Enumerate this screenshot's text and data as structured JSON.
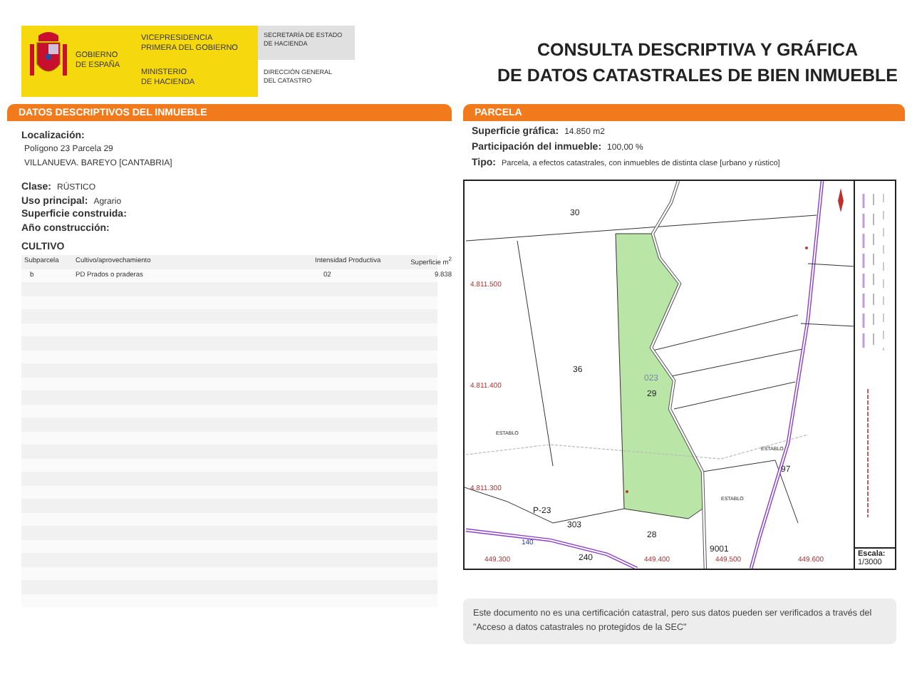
{
  "header": {
    "gov_lines": [
      "GOBIERNO",
      "DE ESPAÑA"
    ],
    "ministry_top": [
      "VICEPRESIDENCIA",
      "PRIMERA DEL GOBIERNO"
    ],
    "ministry_bottom": [
      "MINISTERIO",
      "DE HACIENDA"
    ],
    "secretariat": [
      "SECRETARÍA DE ESTADO",
      "DE HACIENDA"
    ],
    "directorate": [
      "DIRECCIÓN GENERAL",
      "DEL CATASTRO"
    ],
    "title_lines": [
      "CONSULTA DESCRIPTIVA Y GRÁFICA",
      "DE DATOS CATASTRALES DE BIEN INMUEBLE"
    ]
  },
  "descriptive": {
    "title": "DATOS DESCRIPTIVOS DEL INMUEBLE",
    "location_label": "Localización:",
    "location_lines": [
      "Polígono 23 Parcela 29",
      "VILLANUEVA. BAREYO [CANTABRIA]"
    ],
    "fields": [
      {
        "label": "Clase:",
        "value": "RÚSTICO"
      },
      {
        "label": "Uso principal:",
        "value": "Agrario"
      },
      {
        "label": "Superficie construida:"
      },
      {
        "label": "Año construcción:"
      }
    ],
    "cultivo": {
      "title": "CULTIVO",
      "columns": [
        "Subparcela",
        "Cultivo/aprovechamiento",
        "Intensidad Productiva",
        "Superficie m$^{2}$"
      ],
      "rows": [
        [
          "b",
          "PD Prados o praderas",
          "02",
          "9.838"
        ]
      ]
    }
  },
  "parcel": {
    "title": "PARCELA",
    "fields": [
      {
        "label": "Superficie gráfica:",
        "value": "14.850 m2"
      },
      {
        "label": "Participación del inmueble:",
        "value": "100,00 %"
      },
      {
        "label": "Tipo:",
        "value": "Parcela, a efectos catastrales, con inmuebles de distinta clase [urbano y rústico]"
      }
    ],
    "map": {
      "labels": [
        {
          "text": "30",
          "kind": "parcel"
        },
        {
          "text": "4.811.500",
          "kind": "coordinate"
        },
        {
          "text": "36",
          "kind": "parcel"
        },
        {
          "text": "023",
          "kind": "subparcel"
        },
        {
          "text": "29",
          "kind": "parcel"
        },
        {
          "text": "4.811.400",
          "kind": "coordinate"
        },
        {
          "text": "ESTABLO",
          "kind": "building"
        },
        {
          "text": "ESTABLO",
          "kind": "building"
        },
        {
          "text": "ESTABLO",
          "kind": "building"
        },
        {
          "text": "97",
          "kind": "parcel"
        },
        {
          "text": "4.811.300",
          "kind": "coordinate"
        },
        {
          "text": "P-23",
          "kind": "parcel"
        },
        {
          "text": "303",
          "kind": "parcel"
        },
        {
          "text": "28",
          "kind": "parcel"
        },
        {
          "text": "9001",
          "kind": "parcel"
        },
        {
          "text": "140",
          "kind": "road"
        },
        {
          "text": "449.300",
          "kind": "coordinate"
        },
        {
          "text": "240",
          "kind": "parcel"
        },
        {
          "text": "449.400",
          "kind": "coordinate"
        },
        {
          "text": "449.500",
          "kind": "coordinate"
        },
        {
          "text": "449.600",
          "kind": "coordinate"
        }
      ],
      "scale_label": "Escala:",
      "scale": "1/3000"
    }
  },
  "disclaimer": "Este documento no es una certificación catastral, pero sus datos pueden ser verificados a través del \"Acceso a datos catastrales no protegidos de la SEC\""
}
